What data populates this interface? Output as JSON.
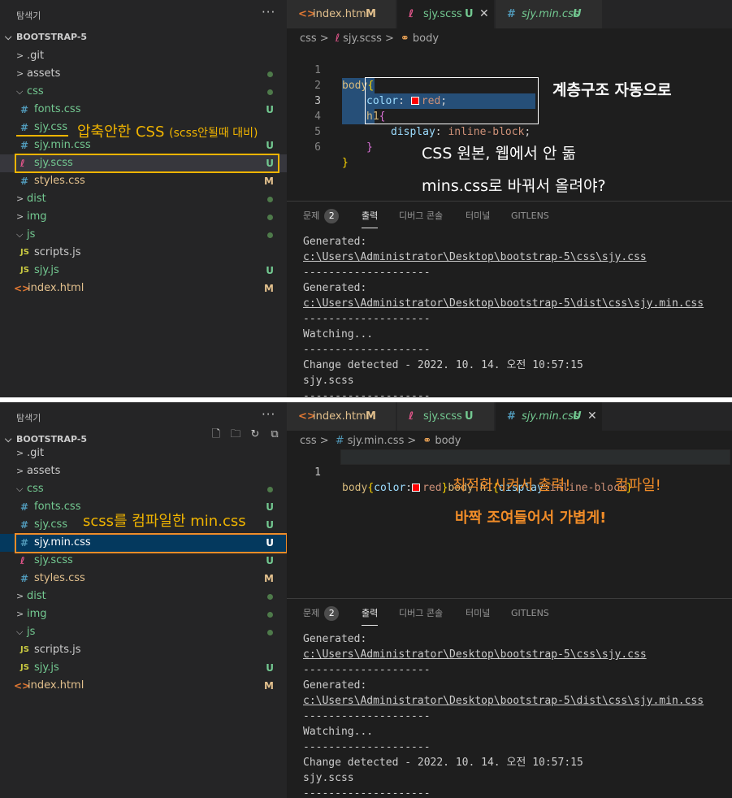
{
  "colors": {
    "annotation_yellow": "#f0b400",
    "annotation_orange": "#f08c28",
    "untracked_green": "#73c991",
    "modified_tan": "#e2c08d"
  },
  "top": {
    "sidebar": {
      "title": "탐색기",
      "more": "···",
      "root": "BOOTSTRAP-5",
      "items": [
        {
          "label": ".git",
          "icon": "chevron-right-icon"
        },
        {
          "label": "assets",
          "icon": "chevron-right-icon"
        },
        {
          "label": "css",
          "icon": "chevron-down-icon"
        },
        {
          "label": "fonts.css",
          "icon": "hash-icon",
          "badge": "U"
        },
        {
          "label": "sjy.css",
          "icon": "hash-icon",
          "badge": ""
        },
        {
          "label": "sjy.min.css",
          "icon": "hash-icon",
          "badge": "U"
        },
        {
          "label": "sjy.scss",
          "icon": "sass-icon",
          "badge": "U"
        },
        {
          "label": "styles.css",
          "icon": "hash-icon",
          "badge": "M"
        },
        {
          "label": "dist",
          "icon": "chevron-right-icon"
        },
        {
          "label": "img",
          "icon": "chevron-right-icon"
        },
        {
          "label": "js",
          "icon": "chevron-down-icon"
        },
        {
          "label": "scripts.js",
          "icon": "js-icon",
          "badge": ""
        },
        {
          "label": "sjy.js",
          "icon": "js-icon",
          "badge": "U"
        },
        {
          "label": "index.html",
          "icon": "html-icon",
          "badge": "M"
        }
      ]
    },
    "tabs": [
      {
        "label": "index.html",
        "badge": "M"
      },
      {
        "label": "sjy.scss",
        "badge": "U",
        "close": "✕"
      },
      {
        "label": "sjy.min.css",
        "badge": "U"
      }
    ],
    "breadcrumb": {
      "folder": "css",
      "file": "sjy.scss",
      "symbol": "body"
    },
    "code": {
      "lines": [
        "1",
        "2",
        "3",
        "4",
        "5",
        "6"
      ],
      "l1_sel": "body",
      "l1_brace": "{",
      "l2_prop": "color",
      "l2_colon": ": ",
      "l2_val": "red",
      "l2_semi": ";",
      "l3_sel": "h1",
      "l3_brace": "{",
      "l4_prop": "display",
      "l4_colon": ": ",
      "l4_val": "inline-block",
      "l4_semi": ";",
      "l5_brace": "}",
      "l6_brace": "}"
    },
    "panel": {
      "tabs": [
        "문제",
        "출력",
        "디버그 콘솔",
        "터미널",
        "GITLENS"
      ],
      "problem_count": "2",
      "output": [
        "Generated:",
        "c:\\Users\\Administrator\\Desktop\\bootstrap-5\\css\\sjy.css",
        "--------------------",
        "Generated:",
        "c:\\Users\\Administrator\\Desktop\\bootstrap-5\\dist\\css\\sjy.min.css",
        "--------------------",
        "Watching...",
        "--------------------",
        "Change detected - 2022. 10. 14. 오전 10:57:15",
        "sjy.scss",
        "--------------------"
      ]
    },
    "annotations": {
      "uncompressed": "압축안한 CSS",
      "uncompressed_small": "(scss안될때 대비)",
      "hierarchy": "계층구조 자동으로",
      "original": "CSS 원본, 웹에서 안 돎",
      "upload": "mins.css로 바꿔서 올려야?"
    }
  },
  "bottom": {
    "sidebar": {
      "title": "탐색기",
      "more": "···",
      "root": "BOOTSTRAP-5",
      "actions": [
        "new-file-icon",
        "new-folder-icon",
        "refresh-icon",
        "collapse-icon"
      ],
      "items": [
        {
          "label": ".git"
        },
        {
          "label": "assets"
        },
        {
          "label": "css"
        },
        {
          "label": "fonts.css",
          "badge": "U"
        },
        {
          "label": "sjy.css",
          "badge": "U"
        },
        {
          "label": "sjy.min.css",
          "badge": "U"
        },
        {
          "label": "sjy.scss",
          "badge": "U"
        },
        {
          "label": "styles.css",
          "badge": "M"
        },
        {
          "label": "dist"
        },
        {
          "label": "img"
        },
        {
          "label": "js"
        },
        {
          "label": "scripts.js",
          "badge": ""
        },
        {
          "label": "sjy.js",
          "badge": "U"
        },
        {
          "label": "index.html",
          "badge": "M"
        }
      ]
    },
    "tabs": [
      {
        "label": "index.html",
        "badge": "M"
      },
      {
        "label": "sjy.scss",
        "badge": "U"
      },
      {
        "label": "sjy.min.css",
        "badge": "U",
        "close": "✕"
      }
    ],
    "breadcrumb": {
      "folder": "css",
      "file": "sjy.min.css",
      "symbol": "body"
    },
    "code": {
      "line": "1",
      "p1": "body",
      "p2": "{",
      "p3": "color",
      "p4": ":",
      "p5": "red",
      "p6": "}",
      "p7": "body h1",
      "p8": "{",
      "p9": "display",
      "p10": ":",
      "p11": "inline-block",
      "p12": "}"
    },
    "annotations": {
      "compiled": "scss를 컴파일한 min.css",
      "optimized": "최적화시켜서 출력!",
      "compile": "컴파일!",
      "light": "바짝 조여들어서 가볍게!"
    }
  }
}
